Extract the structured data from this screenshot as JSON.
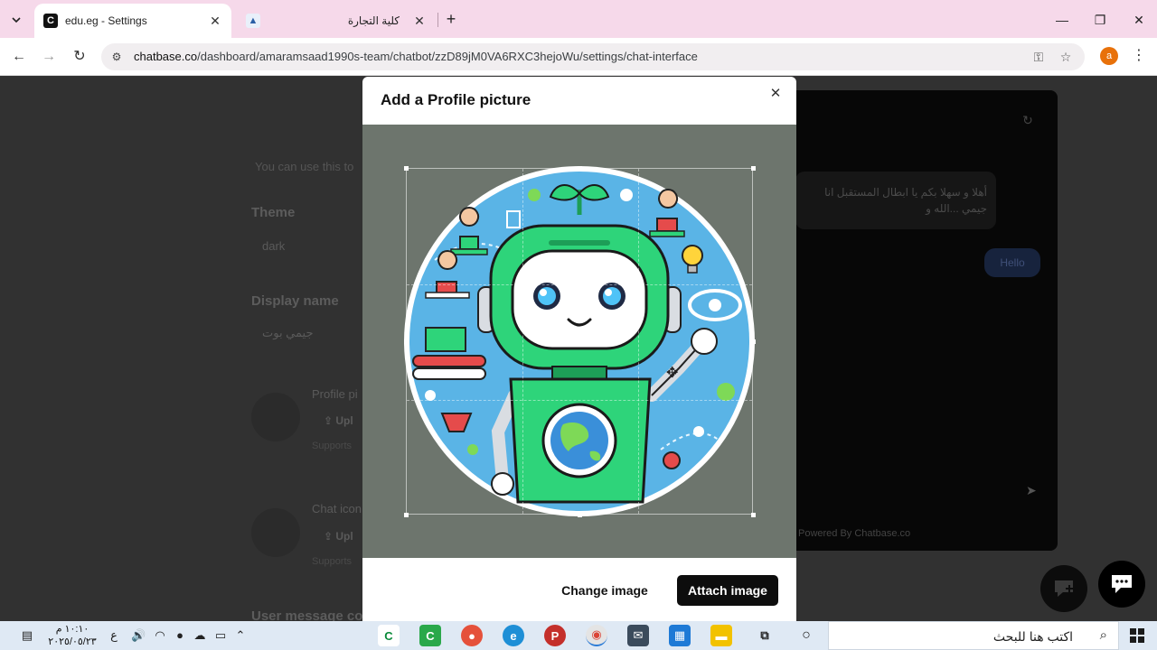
{
  "browser": {
    "tabs": [
      {
        "title": "edu.eg - Settings",
        "active": true
      },
      {
        "title": "كلية التجارة",
        "active": false
      }
    ],
    "url_host": "chatbase.co",
    "url_path": "/dashboard/amaramsaad1990s-team/chatbot/zzD89jM0VA6RXC3hejoWu/settings/chat-interface",
    "profile_initial": "a"
  },
  "page": {
    "intro_text": "You can use this to",
    "theme_label": "Theme",
    "theme_value": "dark",
    "display_name_label": "Display name",
    "display_name_value": "جيمي بوت",
    "profile_picture_label": "Profile pi",
    "profile_upload_label": "Upl",
    "profile_supports": "Supports",
    "chat_icon_label": "Chat icon",
    "chat_upload_label": "Upl",
    "chat_supports": "Supports",
    "user_message_label": "User message co"
  },
  "chat_preview": {
    "bot_message": "أهلا و سهلا بكم يا ابطال المستقبل انا جيمي ...الله و",
    "user_message": "Hello",
    "powered_by": "Powered By Chatbase.co"
  },
  "modal": {
    "title": "Add a Profile picture",
    "change_button": "Change image",
    "attach_button": "Attach image"
  },
  "taskbar": {
    "time": "١٠:١٠ م",
    "date": "٢٠٢٥/٠٥/٢٣",
    "lang": "ع",
    "search_placeholder": "اكتب هنا للبحث"
  },
  "colors": {
    "tabbar": "#f6d9ea",
    "modal_backdrop": "#6d756d",
    "attach_button": "#0d0d0d",
    "robot_green": "#2ed47a",
    "robot_bg_blue": "#5ab4e6"
  }
}
